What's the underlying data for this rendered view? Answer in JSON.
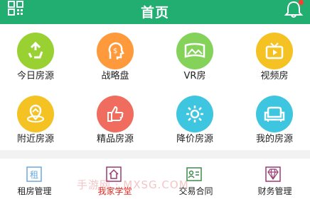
{
  "header": {
    "title": "首页",
    "bg": "#22ad71"
  },
  "quick_links": [
    {
      "label": "今日房源",
      "icon": "recycle-icon",
      "color": "#9ad132"
    },
    {
      "label": "战略盘",
      "icon": "money-head-icon",
      "color": "#ff9a3c"
    },
    {
      "label": "VR房",
      "icon": "panorama-icon",
      "color": "#85d25b"
    },
    {
      "label": "视频房",
      "icon": "video-icon",
      "color": "#f5c223"
    },
    {
      "label": "附近房源",
      "icon": "location-icon",
      "color": "#f5c223"
    },
    {
      "label": "精品房源",
      "icon": "thumbs-up-icon",
      "color": "#f06c5f"
    },
    {
      "label": "降价房源",
      "icon": "sun-icon",
      "color": "#3ec5e0"
    },
    {
      "label": "我的房源",
      "icon": "sofa-icon",
      "color": "#3ec5e0"
    }
  ],
  "bottom_nav": [
    {
      "label": "租房管理",
      "icon": "rent-icon",
      "icon_text": "租",
      "color": "#6aa9e0",
      "active": false
    },
    {
      "label": "我家学堂",
      "icon": "house-icon",
      "color": "#9a3a73",
      "active": true
    },
    {
      "label": "交易合同",
      "icon": "contract-icon",
      "color": "#3f8a4a",
      "active": false
    },
    {
      "label": "财务管理",
      "icon": "diamond-icon",
      "color": "#9a3a73",
      "active": false
    }
  ],
  "watermark": "手游网 · MXSG.COM"
}
